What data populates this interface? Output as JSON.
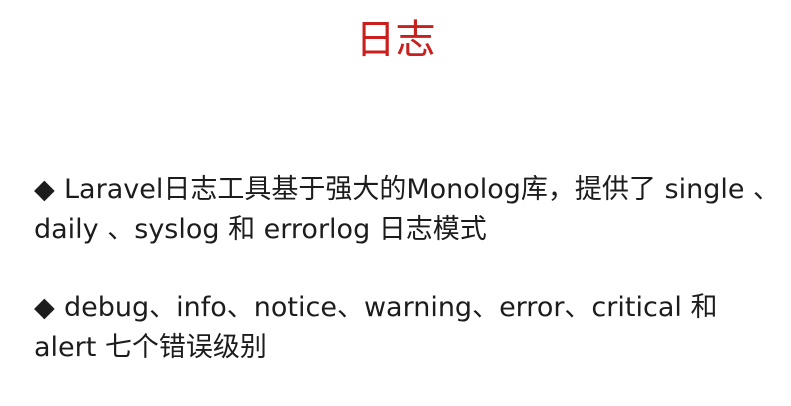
{
  "slide": {
    "title": "日志",
    "title_color": "#c8201e",
    "bullet_marker": "◆",
    "bullets": [
      {
        "text": "Laravel日志工具基于强大的Monolog库，提供了 single 、daily 、syslog 和 errorlog 日志模式"
      },
      {
        "text": "debug、info、notice、warning、error、critical 和 alert 七个错误级别"
      }
    ]
  }
}
